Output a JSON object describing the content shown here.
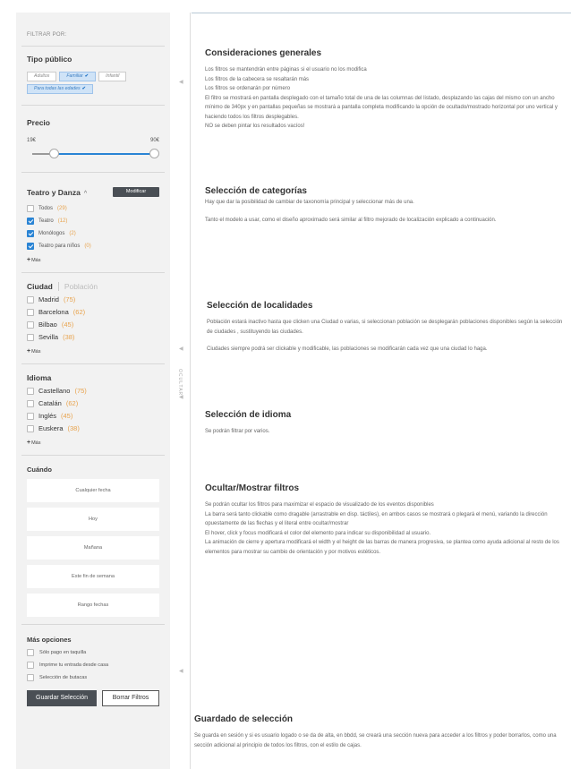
{
  "sidebar": {
    "filtrar_label": "FILTRAR POR:",
    "tipo_publico": {
      "title": "Tipo público",
      "chips": [
        {
          "label": "Adultos",
          "selected": false
        },
        {
          "label": "Familiar",
          "selected": true
        },
        {
          "label": "Infantil",
          "selected": false
        },
        {
          "label": "Para todas las edades",
          "selected": true
        }
      ],
      "check_mark": "✔"
    },
    "precio": {
      "title": "Precio",
      "min_label": "19€",
      "max_label": "90€",
      "range_low_fraction": 0.18,
      "range_high_fraction": 1.0
    },
    "teatro": {
      "title": "Teatro y Danza",
      "chevron": "^",
      "modify_label": "Modificar",
      "items": [
        {
          "label": "Todos",
          "count": "(29)",
          "checked": false
        },
        {
          "label": "Teatro",
          "count": "(12)",
          "checked": true
        },
        {
          "label": "Monólogos",
          "count": "(2)",
          "checked": true
        },
        {
          "label": "Teatro para niños",
          "count": "(0)",
          "checked": true
        }
      ],
      "more_label": "Más"
    },
    "ciudad": {
      "tab_active": "Ciudad",
      "tab_inactive": "Población",
      "items": [
        {
          "label": "Madrid",
          "count": "(75)"
        },
        {
          "label": "Barcelona",
          "count": "(62)"
        },
        {
          "label": "Bilbao",
          "count": "(45)"
        },
        {
          "label": "Sevilla",
          "count": "(38)"
        }
      ],
      "more_label": "Más"
    },
    "idioma": {
      "title": "Idioma",
      "items": [
        {
          "label": "Castellano",
          "count": "(75)"
        },
        {
          "label": "Catalán",
          "count": "(62)"
        },
        {
          "label": "Inglés",
          "count": "(45)"
        },
        {
          "label": "Euskera",
          "count": "(38)"
        }
      ],
      "more_label": "Más"
    },
    "cuando": {
      "title": "Cuándo",
      "options": [
        "Cualquier fecha",
        "Hoy",
        "Mañana",
        "Este fin de semana",
        "Rango fechas"
      ]
    },
    "mas_opciones": {
      "title": "Más opciones",
      "items": [
        "Sólo pago en taquilla",
        "Imprime tu entrada desde casa",
        "Selección de butacas"
      ]
    },
    "save_label": "Guardar Selección",
    "clear_label": "Borrar Filtros"
  },
  "rail": {
    "ocultar_label": "OCULTAR",
    "arrow_glyph": "◀"
  },
  "content": {
    "sections": [
      {
        "title": "Consideraciones generales",
        "paragraphs": [
          "Los filtros se mantendrán entre páginas si el usuario no los modifica",
          "Los filtros de la cabecera se resaltarán más",
          "Los filtros se ordenarán por número",
          "El filtro se mostrará en pantalla desplegado con el tamaño total de una de las columnas del listado, desplazando las cajas del mismo con un ancho mínimo de 340px y en pantallas pequeñas se mostrará a pantalla completa modificando la opción de ocultado/mostrado horizontal por uno vertical y haciendo todos los filtros desplegables.",
          "NO se deben pintar los resultados vacíos!"
        ]
      },
      {
        "title": "Selección de categorías",
        "paragraphs": [
          "Hay que dar la posibilidad de cambiar de taxonomía principal y seleccionar más de una.",
          "",
          "Tanto el modelo a usar, como el diseño aproximado será similar al filtro mejorado de localización explicado a continuación."
        ]
      },
      {
        "title": "Selección de localidades",
        "paragraphs": [
          "Población estará inactivo hasta que clicken una Ciudad o varias, si seleccionan población se desplegarán poblaciones disponibles según la selección de ciudades , sustituyendo las ciudades.",
          "",
          "Ciudades siempre podrá ser clickable y modificable, las poblaciones se modificarán cada vez que una ciudad lo haga."
        ]
      },
      {
        "title": "Selección de idioma",
        "paragraphs": [
          "Se podrán filtrar por varios."
        ]
      },
      {
        "title": "Ocultar/Mostrar filtros",
        "paragraphs": [
          "Se podrán ocultar los filtros para maximizar el espacio de visualizado de los eventos disponibles",
          "La barra será tanto clickable como dragable (arrastrable en disp. táctiles), en ambos casos se mostrará o plegará el menú, variando la dirección opuestamente de las flechas y el literal entre ocultar/mostrar",
          "El hover, click y focus modificará el color del elemento para indicar su disponibilidad al usuario.",
          "La animación de cierre y apertura modificará el width y el height de las barras de manera progresiva, se plantea como ayuda adicional al resto de los elementos para mostrar su cambio de orientación y por motivos estéticos."
        ]
      },
      {
        "title": "Guardado de selección",
        "paragraphs": [
          "Se guarda en sesión y si es usuario logado o se da de alta, en bbdd, se creará una sección nueva para acceder a los filtros y poder borrarlos, como una sección adicional al principio de todos los filtros, con el estilo de cajas."
        ]
      }
    ]
  },
  "colors": {
    "accent": "#2a84d4",
    "count": "#e8a34d",
    "sidebar_bg": "#f2f2f2",
    "dark_button": "#4a4f55"
  }
}
